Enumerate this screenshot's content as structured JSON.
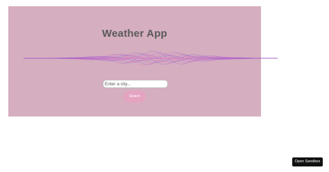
{
  "app": {
    "title": "Weather App"
  },
  "search": {
    "placeholder": "Enter a city...",
    "value": "",
    "button_label": "Search"
  },
  "sandbox": {
    "button_label": "Open Sandbox"
  },
  "colors": {
    "panel_background": "#d5aebf",
    "title_text": "#5a5a5a",
    "wave_primary": "#7a5fd6",
    "wave_secondary": "#e063c0",
    "search_button": "#e4a3c1",
    "sandbox_button": "#111111"
  }
}
